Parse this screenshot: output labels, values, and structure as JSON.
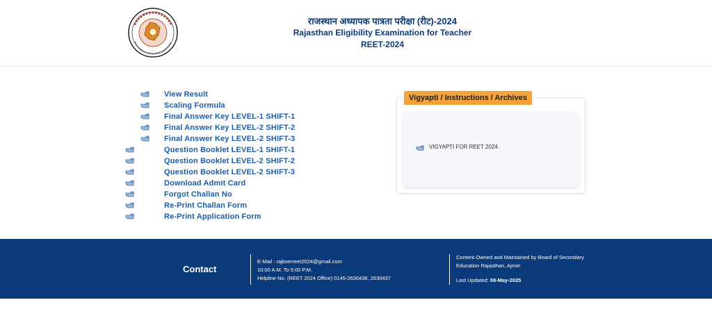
{
  "header": {
    "title_hindi": "राजस्थान अध्यापक पात्रता परीक्षा (रीट)-2024",
    "title_english": "Rajasthan Eligibility Examination for Teacher",
    "title_short": "REET-2024",
    "logo_icon": "board-seal-logo"
  },
  "links": [
    {
      "label": "View Result"
    },
    {
      "label": "Scaling Formula"
    },
    {
      "label": "Final Answer Key LEVEL-1 SHIFT-1"
    },
    {
      "label": "Final Answer Key LEVEL-2 SHIFT-2"
    },
    {
      "label": "Final Answer Key LEVEL-2 SHIFT-3"
    },
    {
      "label": "Question Booklet LEVEL-1 SHIFT-1"
    },
    {
      "label": "Question Booklet LEVEL-2 SHIFT-2"
    },
    {
      "label": "Question Booklet LEVEL-2 SHIFT-3"
    },
    {
      "label": "Download Admit Card"
    },
    {
      "label": "Forgot Challan No"
    },
    {
      "label": "Re-Print Challan Form"
    },
    {
      "label": "Re-Print Application Form"
    }
  ],
  "panel": {
    "tab_label": "Vigyapti / Instructions / Archives",
    "items": [
      {
        "label": "VIGYAPTI FOR REET 2024"
      }
    ]
  },
  "footer": {
    "contact_label": "Contact",
    "email": "E-Mail : rajbserreet2024@gmail.com",
    "hours": "10:00 A.M. To 5:00 P.M.",
    "helpline": "Helpline No. (REET 2024 Office) 0145-2630436, 2630437",
    "owner_line1": "Content Owned and Maintained by Board of Secondary",
    "owner_line2": "Education Rajasthan, Ajmer",
    "updated_label": "Last Updated:",
    "updated_date": "08-May-2025"
  },
  "colors": {
    "brand_blue": "#0b3a7a",
    "link_blue": "#1a5ca8",
    "tab_orange": "#f4a23a"
  }
}
